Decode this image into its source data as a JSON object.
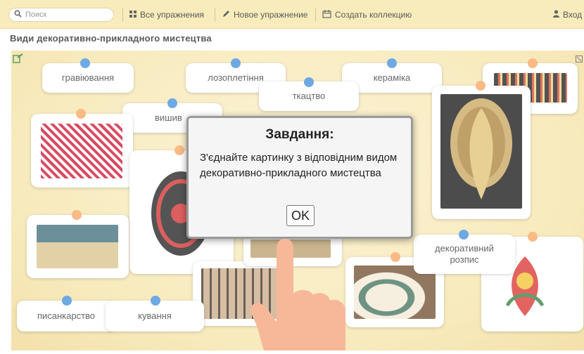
{
  "toolbar": {
    "search_placeholder": "Поиск",
    "all_exercises": "Все упражнения",
    "new_exercise": "Новое упражнение",
    "create_collection": "Создать коллекцию",
    "login": "Вход"
  },
  "page": {
    "title": "Види декоративно-прикладного мистецтва"
  },
  "labels": {
    "engraving": "гравіювання",
    "gilding": "лозоплетіння",
    "ceramics": "кераміка",
    "weaving": "ткацтво",
    "embroidery": "вишив",
    "decorative_painting": "декоративний розпис",
    "pysankarstvo": "писанкарство",
    "forging": "кування"
  },
  "dialog": {
    "title": "Завдання:",
    "text": "З'єднайте картинку з відповідним видом декоративно-прикладного мистецтва",
    "ok_label": "OK"
  },
  "colors": {
    "toolbar_bg": "#f6e6a6",
    "board_bg": "#f7e8b4",
    "dot_blue": "#3f8ddb",
    "dot_orange": "#f7a35c"
  },
  "icons": {
    "search": "magnifier-icon",
    "grid": "grid-icon",
    "pencil": "pencil-icon",
    "collection": "collection-icon",
    "user": "user-icon",
    "help": "help-icon"
  }
}
